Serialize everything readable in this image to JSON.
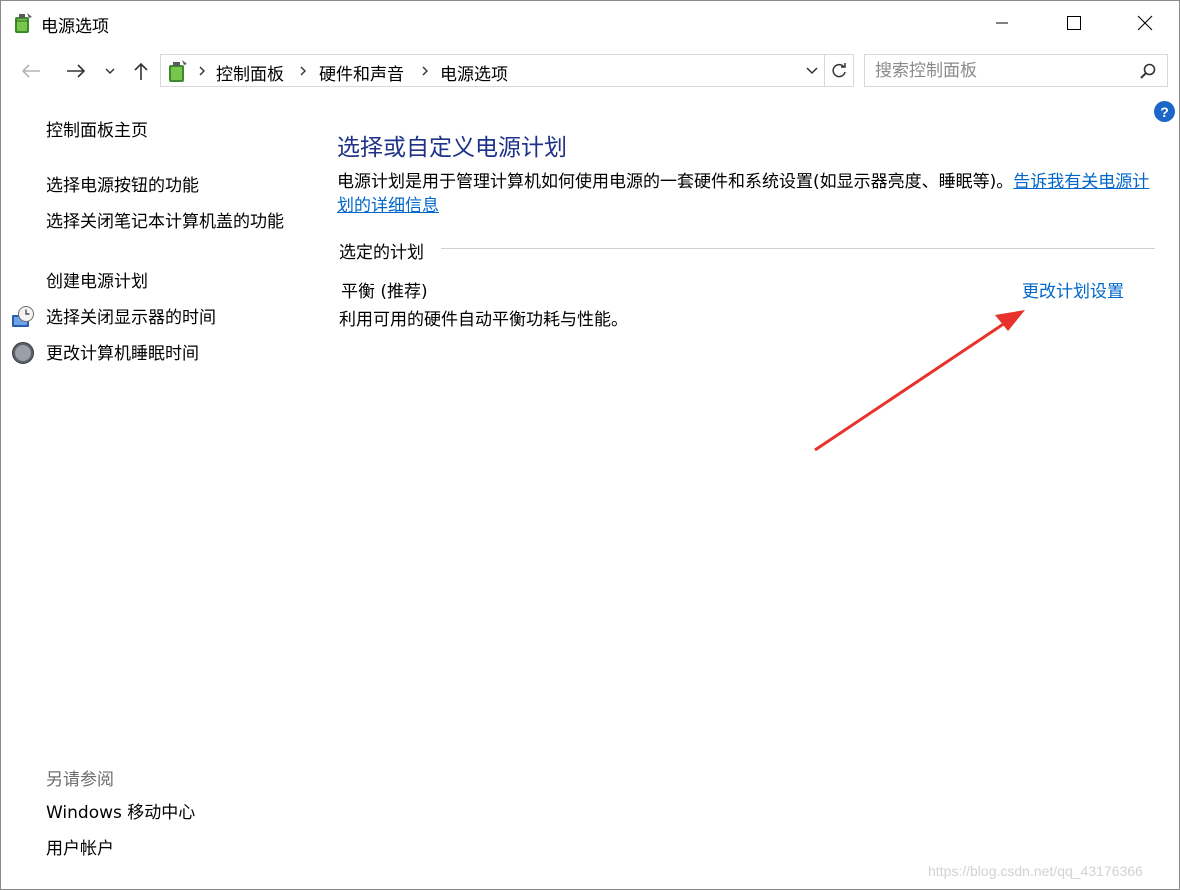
{
  "window": {
    "title": "电源选项",
    "accent_color": "#1e3287",
    "link_color": "#0066cc",
    "icons": [
      "power-options-icon",
      "minimize-icon",
      "maximize-icon",
      "close-icon"
    ]
  },
  "nav": {
    "icons": [
      "back-arrow-icon",
      "forward-arrow-icon",
      "chevron-down-icon",
      "up-arrow-icon"
    ]
  },
  "address": {
    "breadcrumbs": [
      "控制面板",
      "硬件和声音",
      "电源选项"
    ],
    "icons": [
      "control-panel-icon",
      "chevron-right-icon",
      "chevron-down-icon",
      "refresh-icon"
    ]
  },
  "search": {
    "placeholder": "搜索控制面板",
    "icon": "search-icon"
  },
  "help": {
    "label": "?"
  },
  "sidebar": {
    "home": "控制面板主页",
    "items": [
      {
        "label": "选择电源按钮的功能",
        "icon": ""
      },
      {
        "label": "选择关闭笔记本计算机盖的功能",
        "icon": ""
      },
      {
        "label": "创建电源计划",
        "icon": ""
      },
      {
        "label": "选择关闭显示器的时间",
        "icon": "display-clock-icon"
      },
      {
        "label": "更改计算机睡眠时间",
        "icon": "moon-sleep-icon"
      }
    ],
    "see_also_title": "另请参阅",
    "see_also": [
      "Windows 移动中心",
      "用户帐户"
    ]
  },
  "main": {
    "title": "选择或自定义电源计划",
    "description": "电源计划是用于管理计算机如何使用电源的一套硬件和系统设置(如显示器亮度、睡眠等)。",
    "description_link": "告诉我有关电源计划的详细信息",
    "section_label": "选定的计划",
    "plan": {
      "name": "平衡 (推荐)",
      "description": "利用可用的硬件自动平衡功耗与性能。",
      "change_link": "更改计划设置"
    }
  },
  "annotation": {
    "color": "#e8312a",
    "shape": "arrow"
  },
  "watermark": "https://blog.csdn.net/qq_43176366"
}
